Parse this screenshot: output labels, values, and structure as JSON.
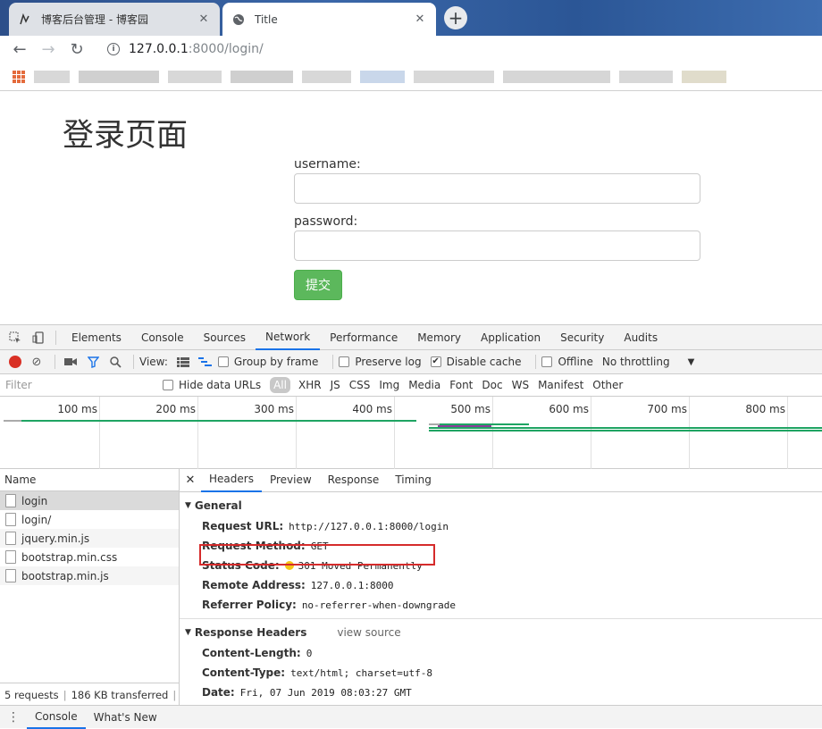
{
  "browser": {
    "tabs": [
      {
        "title": "博客后台管理 - 博客园",
        "favicon": "cnblogs-icon",
        "active": false
      },
      {
        "title": "Title",
        "favicon": "globe-icon",
        "active": true
      }
    ],
    "new_tab_label": "+",
    "url_host": "127.0.0.1",
    "url_path": ":8000/login/"
  },
  "page": {
    "heading": "登录页面",
    "username_label": "username:",
    "password_label": "password:",
    "username_value": "",
    "password_value": "",
    "submit_label": "提交"
  },
  "devtools": {
    "tabs": [
      "Elements",
      "Console",
      "Sources",
      "Network",
      "Performance",
      "Memory",
      "Application",
      "Security",
      "Audits"
    ],
    "selected_tab": "Network",
    "toolbar": {
      "view_label": "View:",
      "group_by_frame": "Group by frame",
      "preserve_log": "Preserve log",
      "disable_cache": "Disable cache",
      "offline": "Offline",
      "throttling": "No throttling"
    },
    "filter": {
      "placeholder": "Filter",
      "hide_data_urls": "Hide data URLs",
      "types": [
        "All",
        "XHR",
        "JS",
        "CSS",
        "Img",
        "Media",
        "Font",
        "Doc",
        "WS",
        "Manifest",
        "Other"
      ]
    },
    "timeline_ticks": [
      "100 ms",
      "200 ms",
      "300 ms",
      "400 ms",
      "500 ms",
      "600 ms",
      "700 ms",
      "800 ms"
    ],
    "name_header": "Name",
    "requests": [
      "login",
      "login/",
      "jquery.min.js",
      "bootstrap.min.css",
      "bootstrap.min.js"
    ],
    "status_summary": {
      "requests": "5 requests",
      "transferred": "186 KB transferred",
      "more": "..."
    },
    "detail_tabs": [
      "Headers",
      "Preview",
      "Response",
      "Timing"
    ],
    "general": {
      "title": "General",
      "request_url_key": "Request URL:",
      "request_url_val": "http://127.0.0.1:8000/login",
      "request_method_key": "Request Method:",
      "request_method_val": "GET",
      "status_code_key": "Status Code:",
      "status_code_val": "301 Moved Permanently",
      "remote_address_key": "Remote Address:",
      "remote_address_val": "127.0.0.1:8000",
      "referrer_policy_key": "Referrer Policy:",
      "referrer_policy_val": "no-referrer-when-downgrade"
    },
    "response_headers": {
      "title": "Response Headers",
      "view_source": "view source",
      "content_length_key": "Content-Length:",
      "content_length_val": "0",
      "content_type_key": "Content-Type:",
      "content_type_val": "text/html; charset=utf-8",
      "date_key": "Date:",
      "date_val": "Fri, 07 Jun 2019 08:03:27 GMT"
    },
    "drawer_tabs": [
      "Console",
      "What's New"
    ]
  },
  "colors": {
    "submit_button": "#5cb85c",
    "record_button": "#d93025",
    "status_dot": "#f5c518",
    "highlight_box": "#d52b2b",
    "selected_tab_underline": "#1a73e8"
  }
}
